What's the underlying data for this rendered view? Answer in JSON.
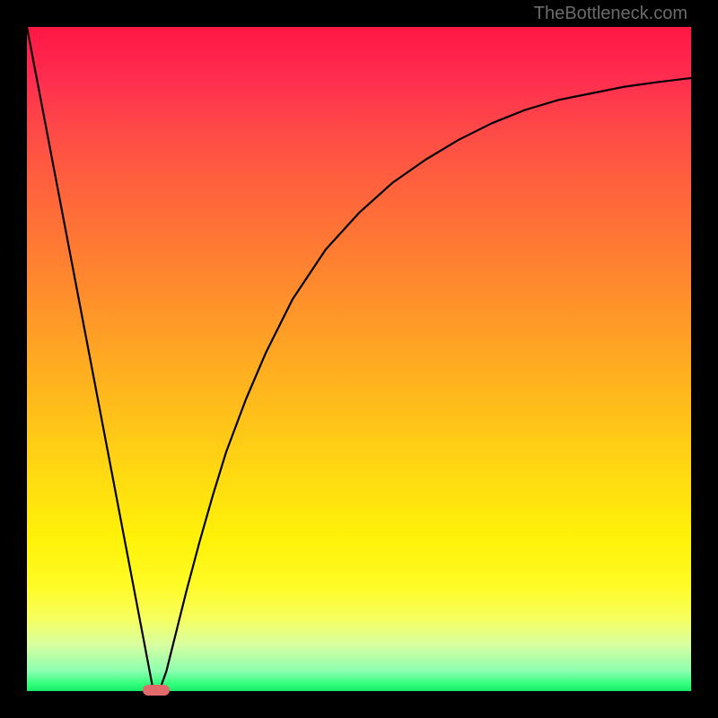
{
  "attribution": "TheBottleneck.com",
  "chart_data": {
    "type": "line",
    "title": "",
    "xlabel": "",
    "ylabel": "",
    "xlim": [
      0,
      100
    ],
    "ylim": [
      0,
      100
    ],
    "x": [
      0,
      2,
      4,
      6,
      8,
      10,
      12,
      14,
      16,
      18,
      19,
      20,
      21,
      22,
      24,
      26,
      28,
      30,
      33,
      36,
      40,
      45,
      50,
      55,
      60,
      65,
      70,
      75,
      80,
      85,
      90,
      95,
      100
    ],
    "values": [
      100,
      89.5,
      79,
      68.5,
      58,
      47.5,
      37,
      26.5,
      16,
      5.5,
      0.2,
      0.2,
      3,
      7,
      15,
      22.5,
      29.5,
      36,
      44,
      51,
      59,
      66.5,
      72,
      76.5,
      80,
      83,
      85.5,
      87.5,
      89,
      90,
      91,
      91.7,
      92.3
    ],
    "marker": {
      "x": 19.5,
      "y": 0.2
    },
    "gradient_stops": [
      {
        "pos": 0,
        "color": "#ff1744"
      },
      {
        "pos": 50,
        "color": "#ffac21"
      },
      {
        "pos": 80,
        "color": "#fff208"
      },
      {
        "pos": 100,
        "color": "#19e86a"
      }
    ]
  }
}
